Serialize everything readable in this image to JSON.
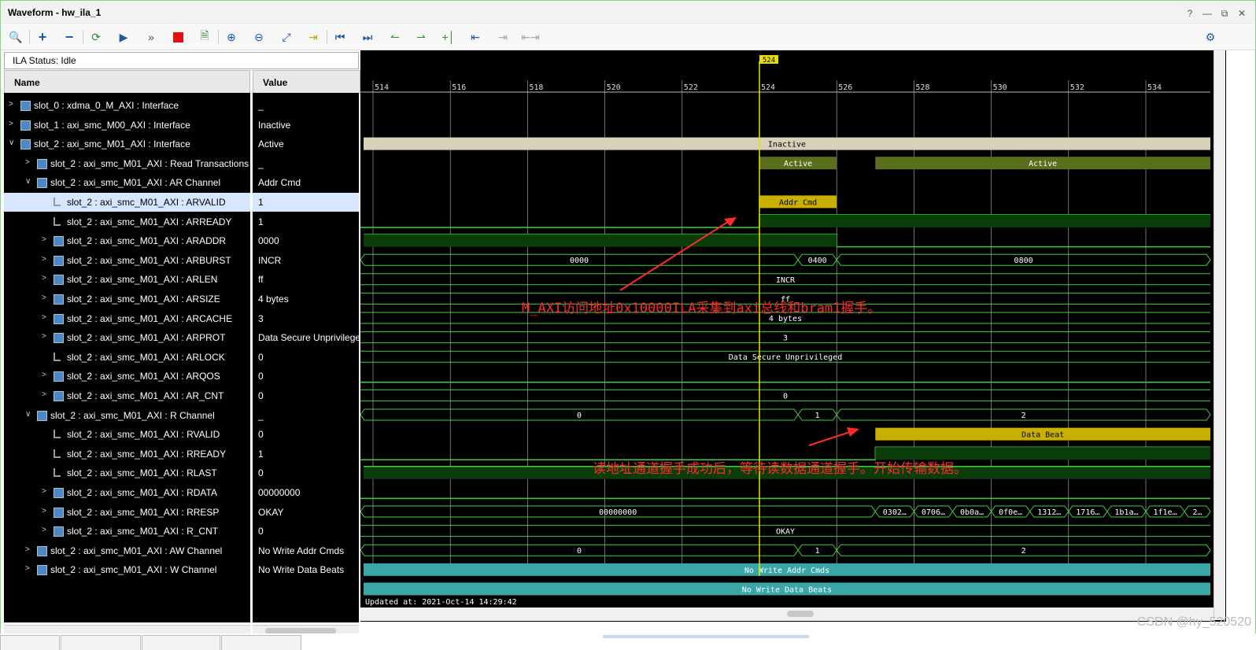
{
  "window": {
    "title": "Waveform - hw_ila_1",
    "controls": [
      "?",
      "—",
      "⧉",
      "✕"
    ]
  },
  "toolbar": {
    "icons": [
      "search-icon",
      "add-icon",
      "remove-icon",
      "refresh-icon",
      "run-icon",
      "run-all-icon",
      "stop-icon",
      "export-icon",
      "zoom-in-icon",
      "zoom-out-icon",
      "zoom-fit-icon",
      "go-to-cursor-icon",
      "go-to-start-icon",
      "go-to-end-icon",
      "prev-transition-icon",
      "next-transition-icon",
      "add-marker-icon",
      "prev-marker-icon",
      "next-marker-icon",
      "swap-cursor-icon",
      "settings-icon"
    ]
  },
  "status": {
    "text": "ILA Status:  Idle"
  },
  "columns": {
    "name": "Name",
    "value": "Value"
  },
  "signals": [
    {
      "name": "slot_0 : xdma_0_M_AXI : Interface",
      "value": "_",
      "arrow": ">",
      "icon": "interface-icon"
    },
    {
      "name": "slot_1 : axi_smc_M00_AXI : Interface",
      "value": "Inactive",
      "arrow": ">",
      "icon": "interface-icon"
    },
    {
      "name": "slot_2 : axi_smc_M01_AXI : Interface",
      "value": "Active",
      "arrow": "v",
      "icon": "interface-icon"
    },
    {
      "name": "slot_2 : axi_smc_M01_AXI : Read Transactions",
      "value": "_",
      "arrow": ">",
      "icon": "interface-icon"
    },
    {
      "name": "slot_2 : axi_smc_M01_AXI : AR Channel",
      "value": "Addr Cmd",
      "arrow": "v",
      "icon": "interface-icon"
    },
    {
      "name": "slot_2 : axi_smc_M01_AXI : ARVALID",
      "value": "1",
      "arrow": "",
      "icon": "signal-icon"
    },
    {
      "name": "slot_2 : axi_smc_M01_AXI : ARREADY",
      "value": "1",
      "arrow": "",
      "icon": "signal-icon"
    },
    {
      "name": "slot_2 : axi_smc_M01_AXI : ARADDR",
      "value": "0000",
      "arrow": ">",
      "icon": "bus-icon"
    },
    {
      "name": "slot_2 : axi_smc_M01_AXI : ARBURST",
      "value": "INCR",
      "arrow": ">",
      "icon": "bus-icon"
    },
    {
      "name": "slot_2 : axi_smc_M01_AXI : ARLEN",
      "value": "ff",
      "arrow": ">",
      "icon": "bus-icon"
    },
    {
      "name": "slot_2 : axi_smc_M01_AXI : ARSIZE",
      "value": "4 bytes",
      "arrow": ">",
      "icon": "bus-icon"
    },
    {
      "name": "slot_2 : axi_smc_M01_AXI : ARCACHE",
      "value": "3",
      "arrow": ">",
      "icon": "bus-icon"
    },
    {
      "name": "slot_2 : axi_smc_M01_AXI : ARPROT",
      "value": "Data Secure Unprivileged",
      "arrow": ">",
      "icon": "bus-icon"
    },
    {
      "name": "slot_2 : axi_smc_M01_AXI : ARLOCK",
      "value": "0",
      "arrow": "",
      "icon": "signal-icon"
    },
    {
      "name": "slot_2 : axi_smc_M01_AXI : ARQOS",
      "value": "0",
      "arrow": ">",
      "icon": "bus-icon"
    },
    {
      "name": "slot_2 : axi_smc_M01_AXI : AR_CNT",
      "value": "0",
      "arrow": ">",
      "icon": "bus-icon"
    },
    {
      "name": "slot_2 : axi_smc_M01_AXI : R Channel",
      "value": "_",
      "arrow": "v",
      "icon": "interface-icon"
    },
    {
      "name": "slot_2 : axi_smc_M01_AXI : RVALID",
      "value": "0",
      "arrow": "",
      "icon": "signal-icon"
    },
    {
      "name": "slot_2 : axi_smc_M01_AXI : RREADY",
      "value": "1",
      "arrow": "",
      "icon": "signal-icon"
    },
    {
      "name": "slot_2 : axi_smc_M01_AXI : RLAST",
      "value": "0",
      "arrow": "",
      "icon": "signal-icon"
    },
    {
      "name": "slot_2 : axi_smc_M01_AXI : RDATA",
      "value": "00000000",
      "arrow": ">",
      "icon": "bus-icon"
    },
    {
      "name": "slot_2 : axi_smc_M01_AXI : RRESP",
      "value": "OKAY",
      "arrow": ">",
      "icon": "bus-icon"
    },
    {
      "name": "slot_2 : axi_smc_M01_AXI : R_CNT",
      "value": "0",
      "arrow": ">",
      "icon": "bus-icon"
    },
    {
      "name": "slot_2 : axi_smc_M01_AXI : AW Channel",
      "value": "No Write Addr Cmds",
      "arrow": ">",
      "icon": "interface-icon"
    },
    {
      "name": "slot_2 : axi_smc_M01_AXI : W Channel",
      "value": "No Write Data Beats",
      "arrow": ">",
      "icon": "interface-icon"
    }
  ],
  "waveform": {
    "cursor_label": "524",
    "time_ticks": [
      "514",
      "516",
      "518",
      "520",
      "522",
      "524",
      "526",
      "528",
      "530",
      "532",
      "534"
    ],
    "updated_at": "Updated at:  2021-Oct-14 14:29:42",
    "labels": {
      "inactive": "Inactive",
      "active": "Active",
      "addr_cmd": "Addr Cmd",
      "araddr": [
        "0000",
        "0400",
        "0800"
      ],
      "arburst": "INCR",
      "arlen": "ff",
      "arsize": "4 bytes",
      "arcache": "3",
      "arprot": "Data Secure Unprivileged",
      "arqos": "0",
      "ar_cnt": [
        "0",
        "1",
        "2"
      ],
      "data_beat": "Data Beat",
      "rdata": [
        "00000000",
        "0302…",
        "0706…",
        "0b0a…",
        "0f0e…",
        "1312…",
        "1716…",
        "1b1a…",
        "1f1e…",
        "2…"
      ],
      "rresp": "OKAY",
      "r_cnt": [
        "0",
        "1",
        "2"
      ],
      "aw": "No Write Addr Cmds",
      "w": "No Write Data Beats"
    },
    "annotations": [
      "M_AXI访问地址0x10000ILA采集到axi总线和bram1握手。",
      "读地址通道握手成功后，等待读数据通道握手。开始传输数据。"
    ],
    "colors": {
      "signal": "#3fcf3f",
      "high_fill": "#0b3d0b",
      "active": "#5a6e1e",
      "inactive": "#d8d0b8",
      "yellow": "#c9b000",
      "teal": "#3aa6a6",
      "cursor": "#e8e000",
      "annotation": "#ff2a2a"
    }
  },
  "watermark": "CSDN @hy_520520"
}
